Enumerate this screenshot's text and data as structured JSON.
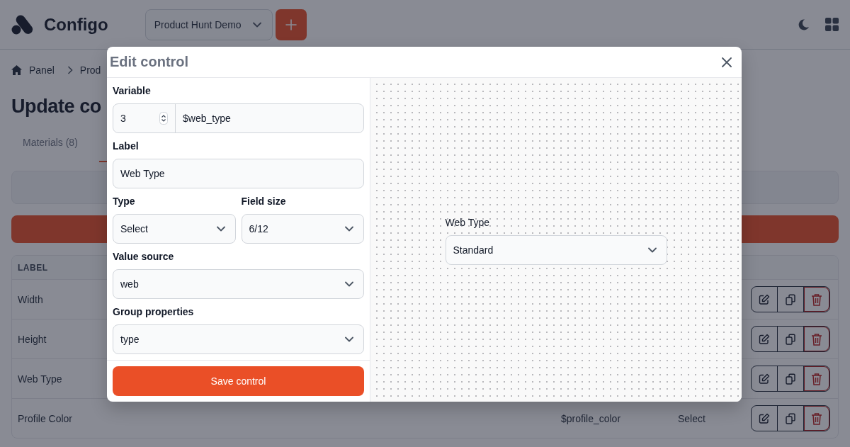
{
  "header": {
    "app_name": "Configo",
    "project_select": {
      "value": "Product Hunt Demo"
    }
  },
  "breadcrumb": [
    {
      "label": "Panel"
    },
    {
      "label": "Prod"
    }
  ],
  "page_title": "Update co",
  "tabs": [
    {
      "label": "Materials (8)",
      "selected": false
    }
  ],
  "table": {
    "columns": [
      "LABEL"
    ],
    "rows": [
      {
        "label": "Width"
      },
      {
        "label": "Height"
      },
      {
        "label": "Web Type"
      },
      {
        "label": "Profile Color",
        "variable": "$profile_color",
        "type": "Select"
      }
    ]
  },
  "modal": {
    "title": "Edit control",
    "fields": [
      {
        "kind": "variable",
        "label": "Variable",
        "index": "3",
        "value": "$web_type"
      },
      {
        "kind": "text",
        "label": "Label",
        "value": "Web Type"
      },
      {
        "kind": "select",
        "label": "Type",
        "value": "Select",
        "half": true
      },
      {
        "kind": "select",
        "label": "Field size",
        "value": "6/12",
        "half": true
      },
      {
        "kind": "select",
        "label": "Value source",
        "value": "web"
      },
      {
        "kind": "select",
        "label": "Group properties",
        "value": "type"
      }
    ],
    "save_button": "Save control",
    "preview": {
      "label": "Web Type",
      "value": "Standard"
    }
  }
}
